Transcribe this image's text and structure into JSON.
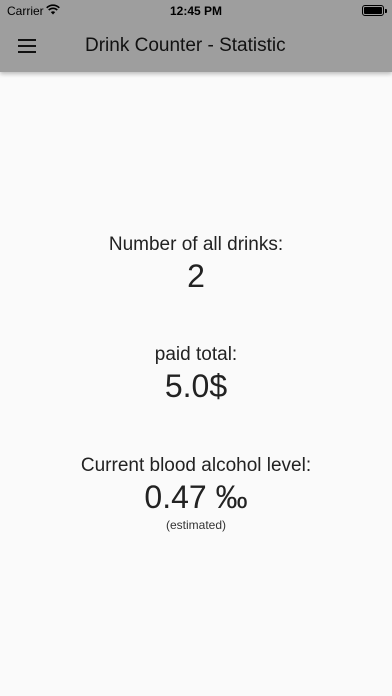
{
  "status_bar": {
    "carrier": "Carrier",
    "time": "12:45 PM"
  },
  "header": {
    "title": "Drink Counter - Statistic",
    "menu_icon": "hamburger-menu-icon"
  },
  "stats": {
    "drinks": {
      "label": "Number of all drinks:",
      "value": "2"
    },
    "paid": {
      "label": "paid total:",
      "value": "5.0$"
    },
    "bac": {
      "label": "Current blood alcohol level:",
      "value": "0.47 ‰",
      "note": "(estimated)"
    }
  },
  "colors": {
    "header_bg": "#9e9e9e",
    "page_bg": "#fafafa"
  }
}
